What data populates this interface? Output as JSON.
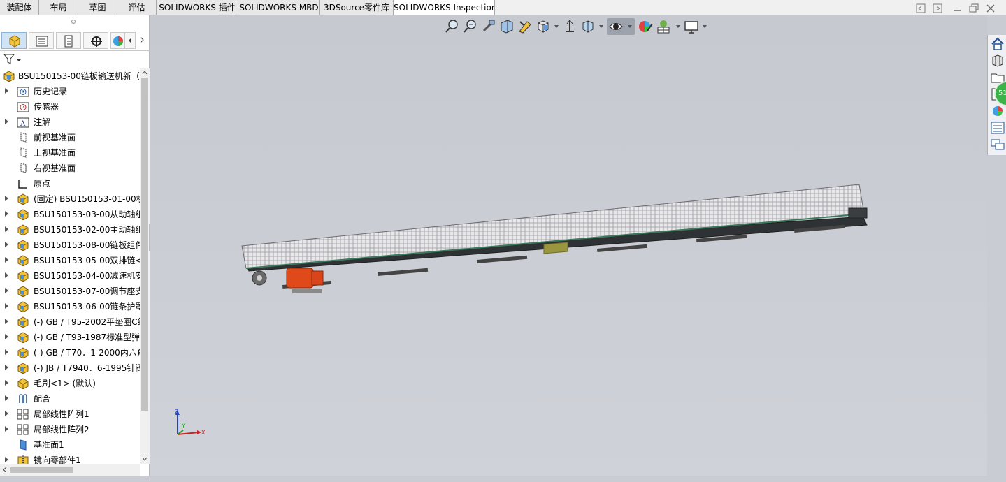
{
  "tabs": [
    {
      "label": "装配体",
      "active": false
    },
    {
      "label": "布局",
      "active": false
    },
    {
      "label": "草图",
      "active": false
    },
    {
      "label": "评估",
      "active": false
    },
    {
      "label": "SOLIDWORKS 插件",
      "active": false
    },
    {
      "label": "SOLIDWORKS MBD",
      "active": false
    },
    {
      "label": "3DSource零件库",
      "active": false
    },
    {
      "label": "SOLIDWORKS Inspection",
      "active": true
    }
  ],
  "window_controls": [
    "restore-left-icon",
    "restore-right-icon",
    "minimize-icon",
    "maximize-icon",
    "close-icon"
  ],
  "manager_tabs": [
    "featuremanager-icon",
    "propertymanager-icon",
    "configurationmanager-icon",
    "dimxpert-icon",
    "display-manager-icon"
  ],
  "tree": {
    "root_label": "BSU150153-00链板输送机新（",
    "items": [
      {
        "label": "历史记录",
        "icon": "history-icon",
        "expandable": true
      },
      {
        "label": "传感器",
        "icon": "sensor-icon",
        "expandable": false
      },
      {
        "label": "注解",
        "icon": "annotation-icon",
        "expandable": true
      },
      {
        "label": "前视基准面",
        "icon": "plane-icon",
        "expandable": false
      },
      {
        "label": "上视基准面",
        "icon": "plane-icon",
        "expandable": false
      },
      {
        "label": "右视基准面",
        "icon": "plane-icon",
        "expandable": false
      },
      {
        "label": "原点",
        "icon": "origin-icon",
        "expandable": false
      },
      {
        "label": "(固定) BSU150153-01-00机",
        "icon": "subassembly-icon",
        "expandable": true
      },
      {
        "label": "BSU150153-03-00从动轴组",
        "icon": "subassembly-icon",
        "expandable": true
      },
      {
        "label": "BSU150153-02-00主动轴组",
        "icon": "subassembly-icon",
        "expandable": true
      },
      {
        "label": "BSU150153-08-00链板组件",
        "icon": "subassembly-icon",
        "expandable": true
      },
      {
        "label": "BSU150153-05-00双排链<",
        "icon": "subassembly-icon",
        "expandable": true
      },
      {
        "label": "BSU150153-04-00减速机安",
        "icon": "subassembly-icon",
        "expandable": true
      },
      {
        "label": "BSU150153-07-00调节座支",
        "icon": "subassembly-icon",
        "expandable": true
      },
      {
        "label": "BSU150153-06-00链条护罩",
        "icon": "subassembly-icon",
        "expandable": true
      },
      {
        "label": "(-) GB / T95-2002平垫圈C级",
        "icon": "subassembly-icon",
        "expandable": true
      },
      {
        "label": "(-) GB / T93-1987标准型弹",
        "icon": "subassembly-icon",
        "expandable": true
      },
      {
        "label": "(-) GB / T70．1-2000内六角",
        "icon": "subassembly-icon",
        "expandable": true
      },
      {
        "label": "(-) JB / T7940．6-1995针阀",
        "icon": "subassembly-icon",
        "expandable": true
      },
      {
        "label": "毛刷<1> (默认)",
        "icon": "part-icon",
        "expandable": true
      },
      {
        "label": "配合",
        "icon": "mates-icon",
        "expandable": true
      },
      {
        "label": "局部线性阵列1",
        "icon": "pattern-icon",
        "expandable": true
      },
      {
        "label": "局部线性阵列2",
        "icon": "pattern-icon",
        "expandable": true
      },
      {
        "label": "基准面1",
        "icon": "plane-solid-icon",
        "expandable": false
      },
      {
        "label": "镜向零部件1",
        "icon": "mirror-icon",
        "expandable": true
      }
    ]
  },
  "hud_tools": [
    "zoom-to-fit-icon",
    "zoom-to-area-icon",
    "previous-view-icon",
    "section-view-icon",
    "dynamic-annotation-icon",
    "view-orientation-icon",
    "display-style-icon",
    "hide-show-items-icon",
    "edit-appearance-icon",
    "apply-scene-icon",
    "view-settings-icon",
    "monitor-icon"
  ],
  "task_pane": [
    "home-icon",
    "design-library-icon",
    "file-explorer-icon",
    "view-palette-icon",
    "appearances-icon",
    "custom-properties-icon",
    "forum-icon"
  ],
  "badge_text": "51",
  "triad": {
    "x": "X",
    "y": "Y",
    "z": "Z"
  },
  "colors": {
    "accent_active": "#cfe3f5",
    "viewport": "#c9ccd3",
    "motor": "#e04a1a",
    "badge": "#3bb24a"
  }
}
